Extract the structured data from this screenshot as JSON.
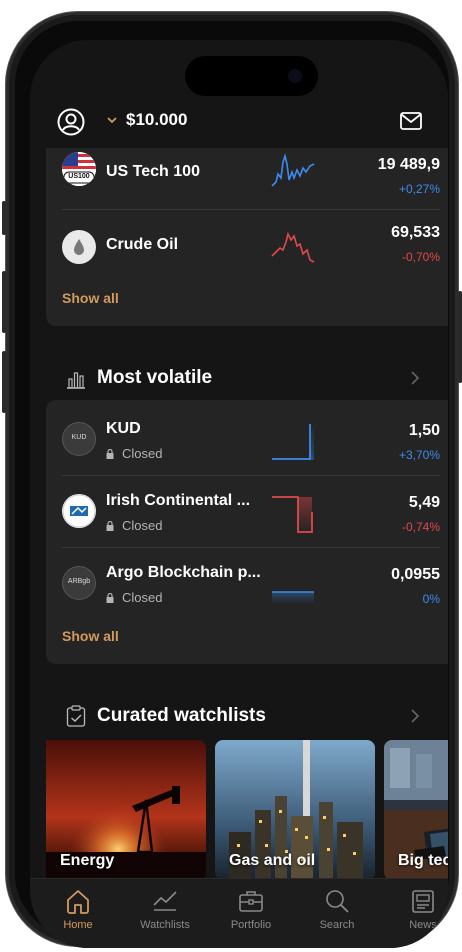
{
  "header": {
    "balance": "$10.000"
  },
  "markets": [
    {
      "name": "US Tech 100",
      "logo_text": "US100",
      "price": "19 489,9",
      "change": "+0,27%",
      "trend": "up"
    },
    {
      "name": "Crude Oil",
      "price": "69,533",
      "change": "-0,70%",
      "trend": "down"
    }
  ],
  "markets_show_all": "Show all",
  "most_volatile": {
    "title": "Most volatile",
    "items": [
      {
        "name": "KUD",
        "logo_text": "KUD",
        "status": "Closed",
        "price": "1,50",
        "change": "+3,70%"
      },
      {
        "name": "Irish Continental ...",
        "status": "Closed",
        "price": "5,49",
        "change": "-0,74%"
      },
      {
        "name": "Argo Blockchain p...",
        "logo_text": "ARBgb",
        "status": "Closed",
        "price": "0,0955",
        "change": "0%"
      }
    ],
    "show_all": "Show all"
  },
  "curated": {
    "title": "Curated watchlists",
    "tiles": [
      {
        "label": "Energy"
      },
      {
        "label": "Gas and oil"
      },
      {
        "label": "Big tech"
      }
    ]
  },
  "tabs": [
    {
      "label": "Home",
      "icon": "home-icon",
      "active": true
    },
    {
      "label": "Watchlists",
      "icon": "chart-line-icon",
      "active": false
    },
    {
      "label": "Portfolio",
      "icon": "briefcase-icon",
      "active": false
    },
    {
      "label": "Search",
      "icon": "search-icon",
      "active": false
    },
    {
      "label": "News",
      "icon": "news-icon",
      "active": false
    }
  ],
  "colors": {
    "accent": "#d19a5e",
    "positive": "#3d8bf0",
    "negative": "#e2484a",
    "background": "#151515",
    "card": "#242424"
  }
}
